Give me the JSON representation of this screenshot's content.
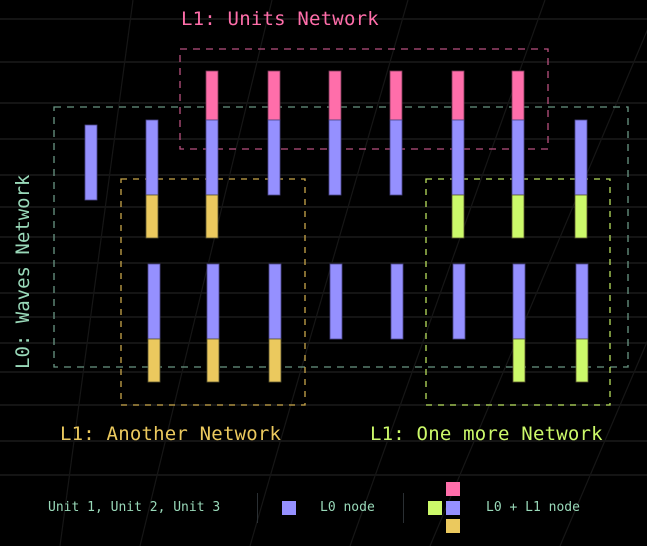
{
  "colors": {
    "background": "#000000",
    "grid": "#1b1b1b",
    "l0_node": "#9590ff",
    "units_network": "#ff6eaa",
    "another_network": "#ebc95e",
    "one_more_network": "#ccf96a",
    "waves_network_label": "#99d9b9",
    "waves_network_box": "#6a9684",
    "units_network_box": "#b8507f",
    "another_network_box": "#c9a64a",
    "one_more_network_box": "#b7de5c",
    "legend_text": "#99d9b9"
  },
  "networks": {
    "l0": {
      "label": "L0: Waves Network"
    },
    "units": {
      "label": "L1: Units Network"
    },
    "another": {
      "label": "L1: Another Network"
    },
    "one_more": {
      "label": "L1: One more Network"
    }
  },
  "nodes": {
    "top_row": [
      {
        "l1": null
      },
      {
        "l1": "another"
      },
      {
        "l1": [
          "units",
          "another"
        ]
      },
      {
        "l1": "units"
      },
      {
        "l1": "units"
      },
      {
        "l1": "units"
      },
      {
        "l1": [
          "units",
          "one_more"
        ]
      },
      {
        "l1": [
          "units",
          "one_more"
        ]
      },
      {
        "l1": "one_more"
      }
    ],
    "bottom_row": [
      {
        "l1": "another"
      },
      {
        "l1": "another"
      },
      {
        "l1": "another"
      },
      {
        "l1": null
      },
      {
        "l1": null
      },
      {
        "l1": null
      },
      {
        "l1": "one_more"
      },
      {
        "l1": "one_more"
      }
    ]
  },
  "legend": {
    "units_label": "Unit 1, Unit 2, Unit 3",
    "l0_node_label": "L0 node",
    "l0_l1_node_label": "L0 + L1 node"
  }
}
